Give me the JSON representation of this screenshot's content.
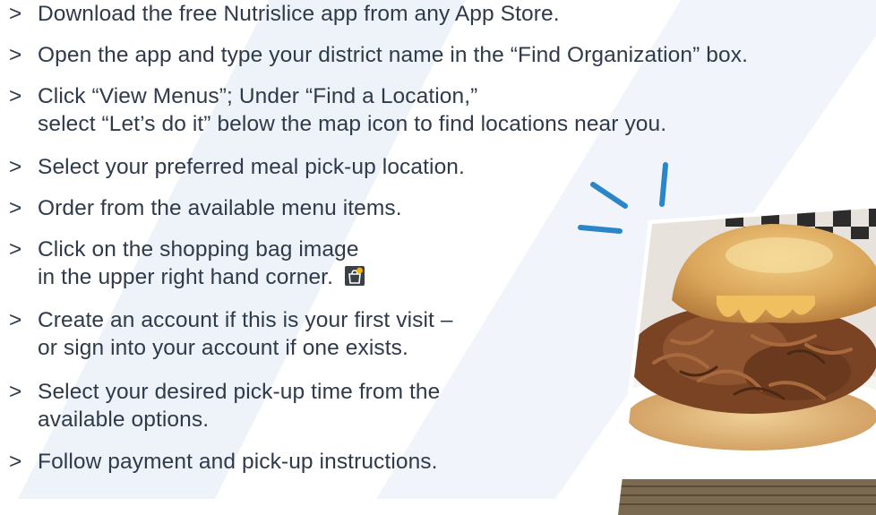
{
  "steps": [
    {
      "lines": [
        "Download the free Nutrislice app from any App Store."
      ]
    },
    {
      "lines": [
        "Open the app and type your district name in the “Find Organization” box."
      ]
    },
    {
      "lines": [
        "Click “View Menus”; Under “Find a Location,”",
        "select “Let’s do it” below the map icon to find locations near you."
      ]
    },
    {
      "lines": [
        "Select your preferred meal pick-up location."
      ]
    },
    {
      "lines": [
        "Order from the available menu items."
      ]
    },
    {
      "lines": [
        "Click on the shopping bag image",
        "in the upper right hand corner."
      ]
    },
    {
      "lines": [
        "Create an account if this is your first visit –",
        "or sign into your account if one exists."
      ]
    },
    {
      "lines": [
        "Select your desired pick-up time from the",
        "available options."
      ]
    },
    {
      "lines": [
        "Follow payment and pick-up instructions."
      ]
    }
  ],
  "bullet_symbol": ">",
  "icons": {
    "shopping_bag": "shopping-bag-icon"
  },
  "colors": {
    "text": "#2f3a4b",
    "accent_blue": "#2a86c8",
    "stripe": "#eef3fa",
    "icon_bag": "#3b3f46",
    "icon_dot": "#f5b400"
  }
}
